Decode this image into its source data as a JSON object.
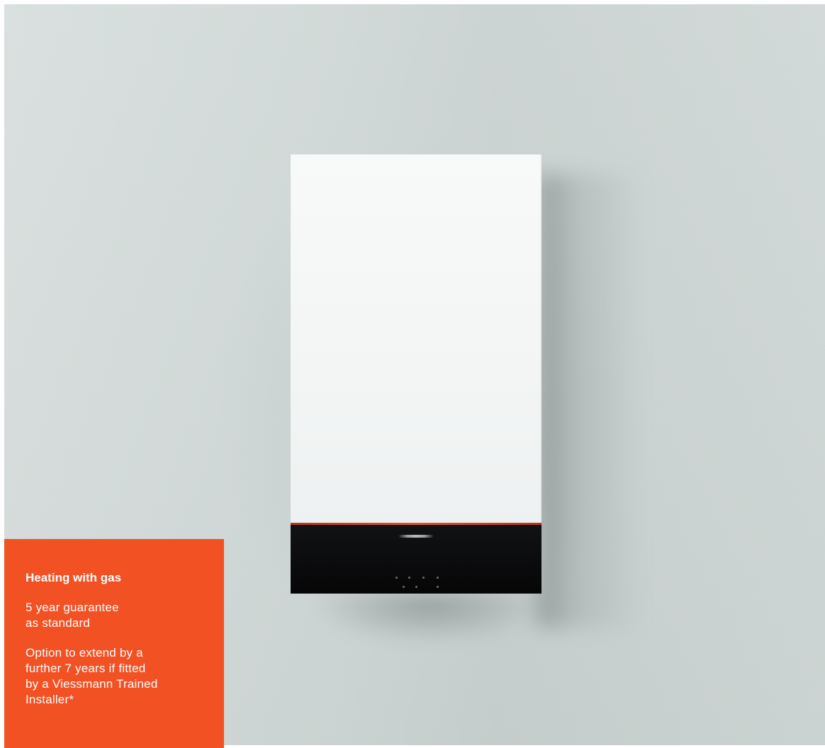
{
  "info_box": {
    "title": "Heating with gas",
    "guarantee_line1": "5 year guarantee",
    "guarantee_line2": "as standard",
    "option_line1": "Option to extend by a",
    "option_line2": "further 7 years if fitted",
    "option_line3": "by a Viessmann Trained",
    "option_line4": "Installer*"
  },
  "colors": {
    "accent": "#f25124",
    "wall": "#cfd7d6",
    "boiler_front": "#f5f7f7",
    "control_panel": "#0a0a0b"
  },
  "icons": {
    "logo": "viessmann-logo-mark"
  }
}
